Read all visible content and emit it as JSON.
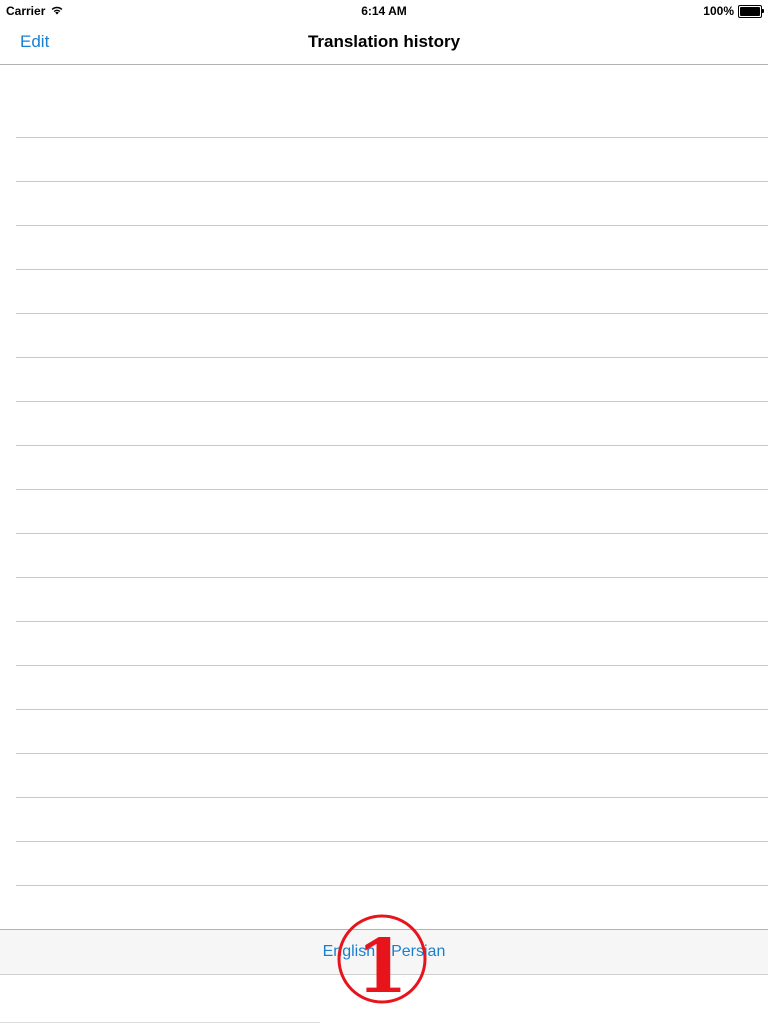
{
  "status_bar": {
    "carrier": "Carrier",
    "time": "6:14 AM",
    "battery_percent": "100%",
    "battery_level": 1.0
  },
  "nav_bar": {
    "edit_label": "Edit",
    "title": "Translation history"
  },
  "history": {
    "rows": [
      "",
      "",
      "",
      "",
      "",
      "",
      "",
      "",
      "",
      "",
      "",
      "",
      "",
      "",
      "",
      "",
      "",
      "",
      "",
      ""
    ]
  },
  "toolbar": {
    "language_pair": "English⇔Persian"
  },
  "annotation": {
    "marker_label": "1",
    "color": "#e8141c"
  },
  "colors": {
    "accent": "#1a7fd0",
    "separator": "#c8c7cc"
  }
}
